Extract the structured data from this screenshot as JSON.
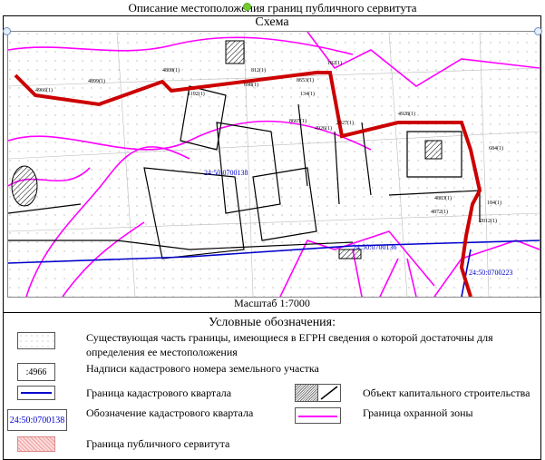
{
  "title": "Описание местоположения границ публичного сервитута",
  "schema_label": "Схема",
  "scale_label": "Масштаб 1:7000",
  "map": {
    "parcel_labels": [
      "4966(1)",
      "4899(1)",
      "4808(1)",
      "812(1)",
      "1192(1)",
      "698(1)",
      "8653(1)",
      "134(1)",
      "182(1)",
      "4928(1)",
      "4926(1)",
      "8665(1)",
      "2027(1)",
      "4883(1)",
      "4872(1)",
      "684(1)",
      "184(1)",
      "2012(1)"
    ],
    "quarter_labels": [
      "24:50:0700138",
      "24:50:0700136",
      "24:50:0700223"
    ],
    "colors": {
      "servitude": "#c00000",
      "quarter": "#0000cc",
      "protection_zone": "#ff00ff",
      "objects": "#000000"
    }
  },
  "legend": {
    "title": "Условные обозначения:",
    "items": [
      {
        "label": "Существующая часть границы, имеющиеся в ЕГРН сведения о которой достаточны для определения ее местоположения"
      },
      {
        "label": "Надписи кадастрового номера земельного участка",
        "sample": ":4966"
      },
      {
        "label": "Граница кадастрового квартала"
      },
      {
        "label": "Обозначение кадастрового квартала",
        "sample": "24:50:0700138"
      },
      {
        "label": "Граница публичного сервитута"
      },
      {
        "label": "Объект капитального строительства"
      },
      {
        "label": "Граница охранной зоны"
      }
    ]
  }
}
